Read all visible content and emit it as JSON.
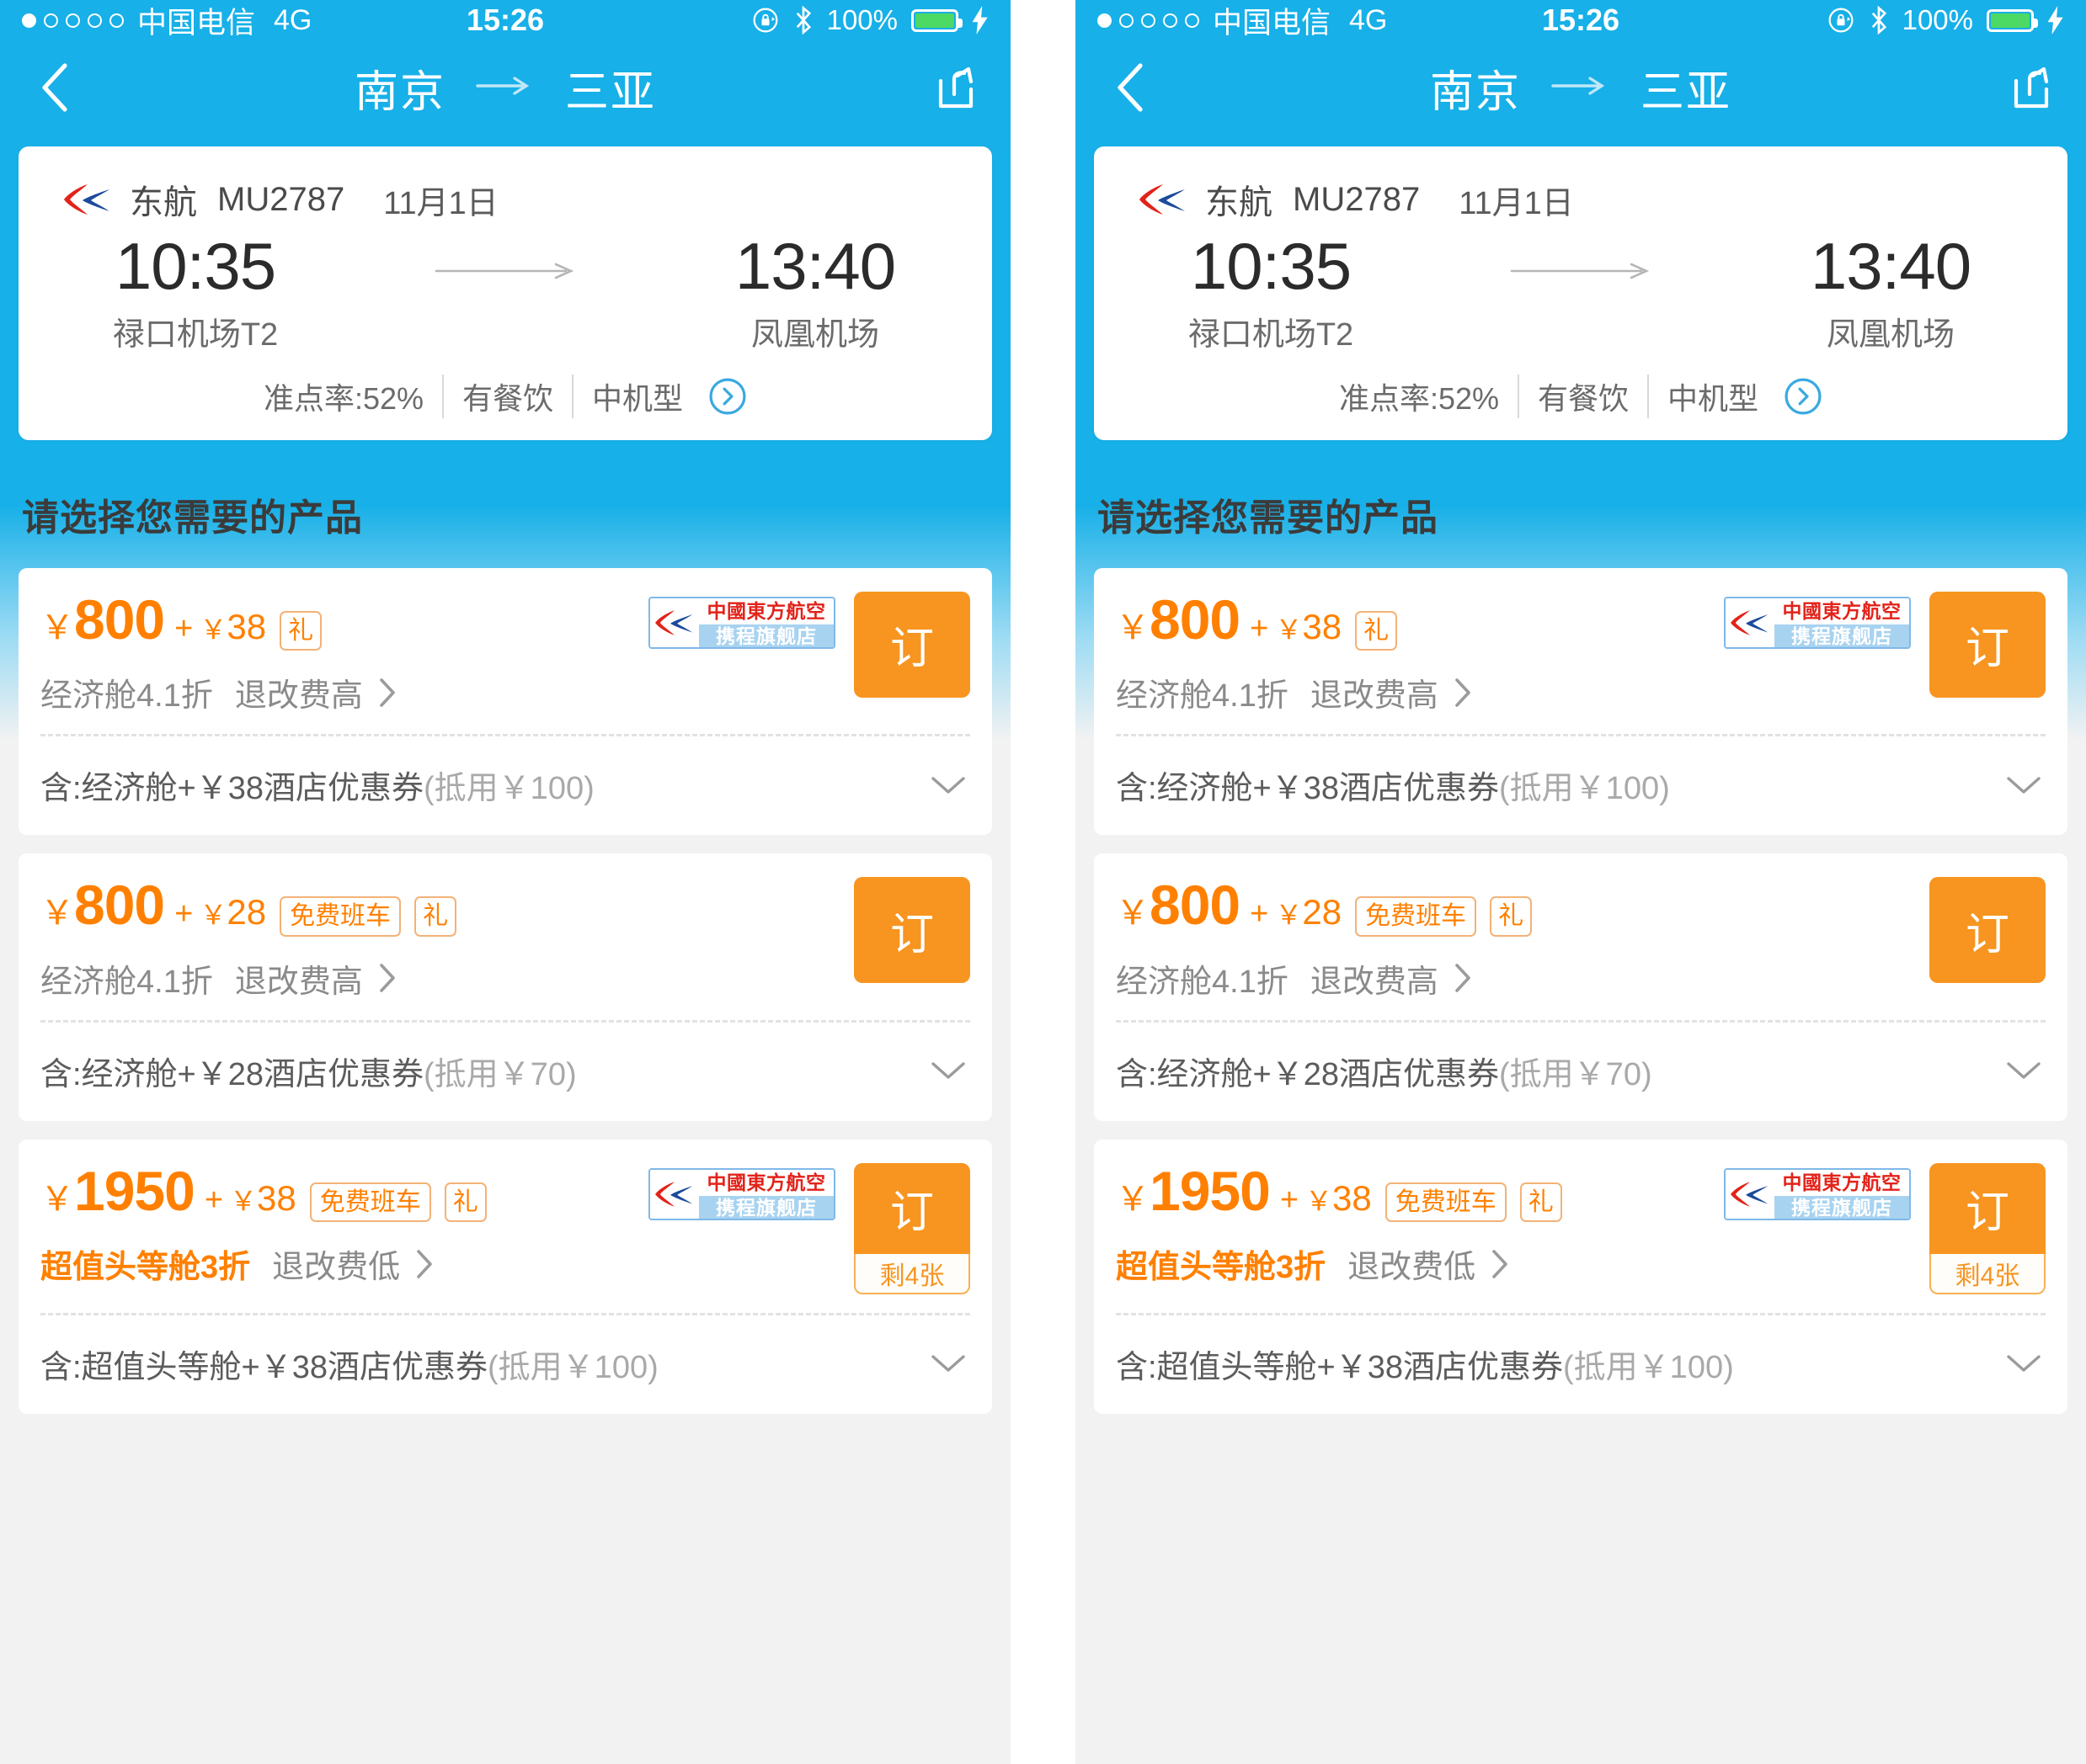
{
  "status_bar": {
    "signal_dots": 5,
    "signal_filled": 1,
    "carrier": "中国电信",
    "network": "4G",
    "time": "15:26",
    "battery_percent": "100%",
    "battery_level": 100,
    "icons": [
      "rotation-lock-icon",
      "bluetooth-icon",
      "battery-icon",
      "charging-bolt-icon"
    ]
  },
  "nav": {
    "back_label": "返回",
    "origin": "南京",
    "arrow": "→",
    "destination": "三亚",
    "share_label": "分享"
  },
  "flight": {
    "airline": "东航",
    "flight_no": "MU2787",
    "date": "11月1日",
    "depart_time": "10:35",
    "depart_airport": "禄口机场T2",
    "arrive_time": "13:40",
    "arrive_airport": "凤凰机场",
    "meta": [
      "准点率:52%",
      "有餐饮",
      "中机型"
    ]
  },
  "section": {
    "title": "请选择您需要的产品"
  },
  "colors": {
    "header_blue": "#17b0e8",
    "accent_orange": "#ff8000",
    "button_orange": "#f79520",
    "tag_border": "#f3b277",
    "airline_red": "#e2231a",
    "store_blue": "#a8d3f0"
  },
  "products": [
    {
      "yen": "￥",
      "price": "800",
      "plus": "+",
      "yen2": "￥",
      "addon": "38",
      "tags": [
        "礼"
      ],
      "has_store_badge": true,
      "cabin": "经济舱4.1折",
      "cabin_highlight": false,
      "refund": "退改费高",
      "book_label": "订",
      "remain": null,
      "includes_prefix": "含:经济舱+￥38酒店优惠券",
      "includes_suffix": "(抵用￥100)"
    },
    {
      "yen": "￥",
      "price": "800",
      "plus": "+",
      "yen2": "￥",
      "addon": "28",
      "tags": [
        "免费班车",
        "礼"
      ],
      "has_store_badge": false,
      "cabin": "经济舱4.1折",
      "cabin_highlight": false,
      "refund": "退改费高",
      "book_label": "订",
      "remain": null,
      "includes_prefix": "含:经济舱+￥28酒店优惠券",
      "includes_suffix": "(抵用￥70)"
    },
    {
      "yen": "￥",
      "price": "1950",
      "plus": "+",
      "yen2": "￥",
      "addon": "38",
      "tags": [
        "免费班车",
        "礼"
      ],
      "has_store_badge": true,
      "cabin": "超值头等舱3折",
      "cabin_highlight": true,
      "refund": "退改费低",
      "book_label": "订",
      "remain": "剩4张",
      "includes_prefix": "含:超值头等舱+￥38酒店优惠券",
      "includes_suffix": "(抵用￥100)"
    }
  ],
  "store_badge": {
    "line1": "中國東方航空",
    "line2": "携程旗舰店"
  }
}
